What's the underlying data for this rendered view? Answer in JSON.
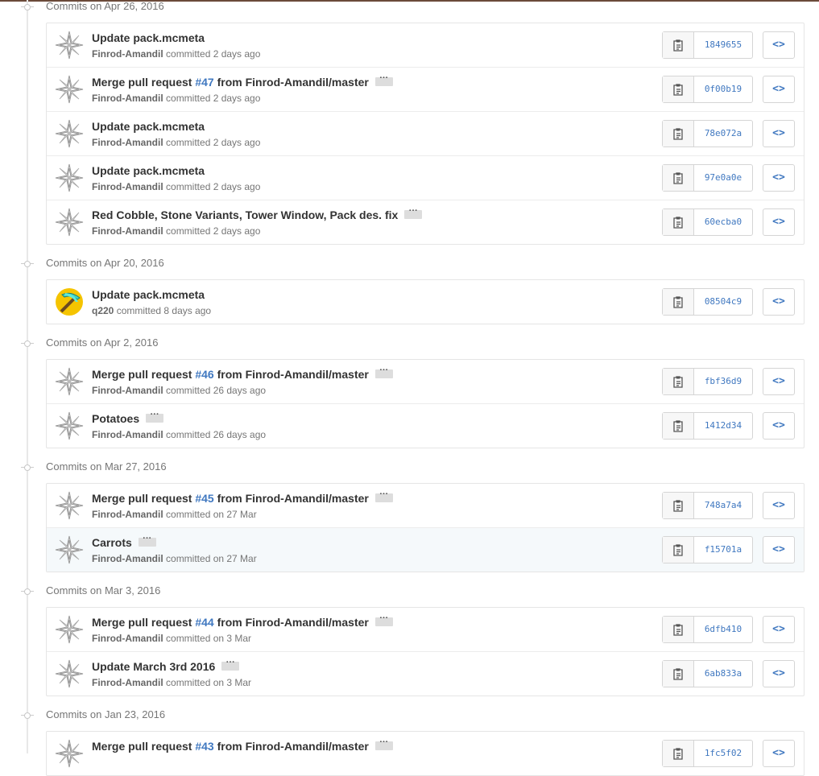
{
  "groups": [
    {
      "title": "Commits on Apr 26, 2016",
      "commits": [
        {
          "avatar": "star-avatar",
          "msg_pre": "Update pack.mcmeta",
          "pr": "",
          "msg_post": "",
          "ellipsis": false,
          "author": "Finrod-Amandil",
          "time": "committed 2 days ago",
          "sha": "1849655"
        },
        {
          "avatar": "star-avatar",
          "msg_pre": "Merge pull request ",
          "pr": "#47",
          "msg_post": " from Finrod-Amandil/master",
          "ellipsis": true,
          "author": "Finrod-Amandil",
          "time": "committed 2 days ago",
          "sha": "0f00b19"
        },
        {
          "avatar": "star-avatar",
          "msg_pre": "Update pack.mcmeta",
          "pr": "",
          "msg_post": "",
          "ellipsis": false,
          "author": "Finrod-Amandil",
          "time": "committed 2 days ago",
          "sha": "78e072a"
        },
        {
          "avatar": "star-avatar",
          "msg_pre": "Update pack.mcmeta",
          "pr": "",
          "msg_post": "",
          "ellipsis": false,
          "author": "Finrod-Amandil",
          "time": "committed 2 days ago",
          "sha": "97e0a0e"
        },
        {
          "avatar": "star-avatar",
          "msg_pre": "Red Cobble, Stone Variants, Tower Window, Pack des. fix",
          "pr": "",
          "msg_post": "",
          "ellipsis": true,
          "author": "Finrod-Amandil",
          "time": "committed 2 days ago",
          "sha": "60ecba0"
        }
      ]
    },
    {
      "title": "Commits on Apr 20, 2016",
      "commits": [
        {
          "avatar": "pickaxe-avatar",
          "msg_pre": "Update pack.mcmeta",
          "pr": "",
          "msg_post": "",
          "ellipsis": false,
          "author": "q220",
          "time": "committed 8 days ago",
          "sha": "08504c9"
        }
      ]
    },
    {
      "title": "Commits on Apr 2, 2016",
      "commits": [
        {
          "avatar": "star-avatar",
          "msg_pre": "Merge pull request ",
          "pr": "#46",
          "msg_post": " from Finrod-Amandil/master",
          "ellipsis": true,
          "author": "Finrod-Amandil",
          "time": "committed 26 days ago",
          "sha": "fbf36d9"
        },
        {
          "avatar": "star-avatar",
          "msg_pre": "Potatoes",
          "pr": "",
          "msg_post": "",
          "ellipsis": true,
          "author": "Finrod-Amandil",
          "time": "committed 26 days ago",
          "sha": "1412d34"
        }
      ]
    },
    {
      "title": "Commits on Mar 27, 2016",
      "commits": [
        {
          "avatar": "star-avatar",
          "msg_pre": "Merge pull request ",
          "pr": "#45",
          "msg_post": " from Finrod-Amandil/master",
          "ellipsis": true,
          "author": "Finrod-Amandil",
          "time": "committed on 27 Mar",
          "sha": "748a7a4"
        },
        {
          "avatar": "star-avatar",
          "msg_pre": "Carrots",
          "pr": "",
          "msg_post": "",
          "ellipsis": true,
          "author": "Finrod-Amandil",
          "time": "committed on 27 Mar",
          "sha": "f15701a",
          "highlight": true
        }
      ]
    },
    {
      "title": "Commits on Mar 3, 2016",
      "commits": [
        {
          "avatar": "star-avatar",
          "msg_pre": "Merge pull request ",
          "pr": "#44",
          "msg_post": " from Finrod-Amandil/master",
          "ellipsis": true,
          "author": "Finrod-Amandil",
          "time": "committed on 3 Mar",
          "sha": "6dfb410"
        },
        {
          "avatar": "star-avatar",
          "msg_pre": "Update March 3rd 2016",
          "pr": "",
          "msg_post": "",
          "ellipsis": true,
          "author": "Finrod-Amandil",
          "time": "committed on 3 Mar",
          "sha": "6ab833a"
        }
      ]
    },
    {
      "title": "Commits on Jan 23, 2016",
      "commits": [
        {
          "avatar": "star-avatar",
          "msg_pre": "Merge pull request ",
          "pr": "#43",
          "msg_post": " from Finrod-Amandil/master",
          "ellipsis": true,
          "author": "",
          "time": "",
          "sha": "1fc5f02"
        }
      ]
    }
  ],
  "icons": {
    "copy": "clipboard-icon",
    "browse": "code-brackets-icon",
    "browse_glyph": "<>"
  },
  "colors": {
    "link": "#4078c0",
    "highlight_row": "#f5f9fb"
  }
}
